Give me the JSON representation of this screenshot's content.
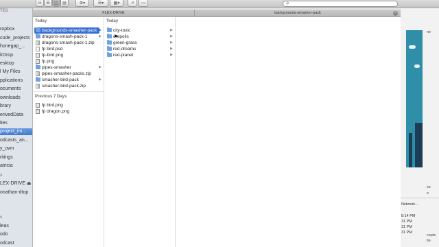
{
  "window": {
    "tabs": [
      {
        "label": "FLEX-DRIVE"
      },
      {
        "label": "backgrounds-smasher-pack"
      }
    ]
  },
  "toolbar": {
    "view_icon": "view-columns-icon",
    "action_icon": "gear-icon",
    "arrange_icon": "arrange-icon",
    "share_icon": "share-icon",
    "tags_icon": "tag-icon",
    "search_icon": "search-icon"
  },
  "sidebar": {
    "items": [
      {
        "label": "TES"
      },
      {
        "label": "ropbox"
      },
      {
        "label": "code_projects"
      },
      {
        "label": "honegap_..."
      },
      {
        "label": "irDrop"
      },
      {
        "label": "esktop"
      },
      {
        "label": "l My Files"
      },
      {
        "label": "pplications"
      },
      {
        "label": "ocuments"
      },
      {
        "label": "ownloads"
      },
      {
        "label": "brary"
      },
      {
        "label": "erivedData"
      },
      {
        "label": "ites"
      },
      {
        "label": "project_im..."
      },
      {
        "label": "odcasts_an..."
      },
      {
        "label": "y_own"
      },
      {
        "label": "ritings"
      },
      {
        "label": "atricia"
      },
      {
        "label": "s"
      },
      {
        "label": "LEX-DRIVE ⏏"
      },
      {
        "label": "onathan-dtop"
      },
      {
        "label": "s"
      },
      {
        "label": "leas"
      },
      {
        "label": "odo"
      },
      {
        "label": "odcast"
      }
    ]
  },
  "column1": {
    "group_today": "Today",
    "items": [
      {
        "label": "backgrounds-smasher-pack",
        "kind": "folder",
        "has_children": true
      },
      {
        "label": "dragons-smash-pack-1",
        "kind": "folder",
        "has_children": true
      },
      {
        "label": "dragons-smash-pack-1.zip",
        "kind": "zip",
        "has_children": false
      },
      {
        "label": "fp bird.psd",
        "kind": "file",
        "has_children": false
      },
      {
        "label": "fp-bird.png",
        "kind": "png",
        "has_children": false
      },
      {
        "label": "fp.png",
        "kind": "png",
        "has_children": false
      },
      {
        "label": "pipes-smasher",
        "kind": "folder",
        "has_children": true
      },
      {
        "label": "pipes-smasher-packs.zip",
        "kind": "zip",
        "has_children": false
      },
      {
        "label": "smasher-bird-pack",
        "kind": "folder",
        "has_children": true
      },
      {
        "label": "smasher-bird-pack.zip",
        "kind": "zip",
        "has_children": false
      }
    ],
    "group_prev": "Previous 7 Days",
    "prev_items": [
      {
        "label": "fp bird.png",
        "kind": "png"
      },
      {
        "label": "fp dragon.png",
        "kind": "png"
      }
    ]
  },
  "column2": {
    "group_today": "Today",
    "items": [
      {
        "label": "city-toxic"
      },
      {
        "label": "erepolis"
      },
      {
        "label": "green-grass"
      },
      {
        "label": "red-dreams"
      },
      {
        "label": "red-planet"
      }
    ]
  },
  "background_app": {
    "lines": [
      "Network...",
      "8:14 PM",
      "31 PM",
      "31 PM",
      "31 PM"
    ],
    "side_lines": [
      "ne",
      "se",
      "e",
      "cepts",
      "ite"
    ]
  },
  "colors": {
    "selection": "#3a6fd1",
    "folder": "#6fa3e0",
    "sidebar_bg": "#dfe4ea"
  }
}
